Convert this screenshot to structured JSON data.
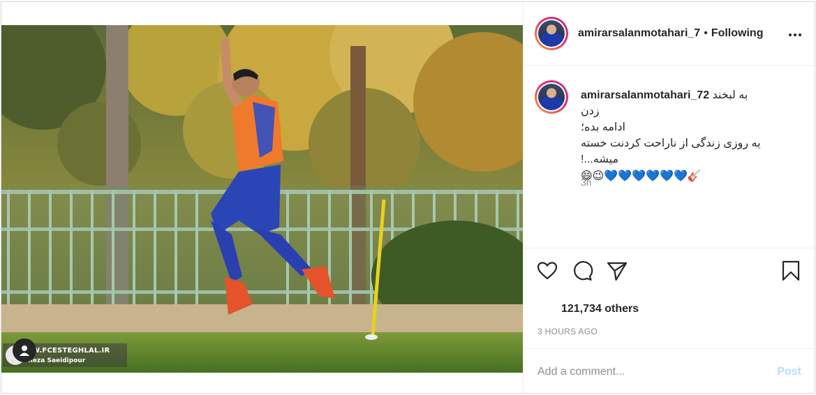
{
  "post": {
    "image": {
      "watermark_site": "W.FCESTEGHLAL.IR",
      "watermark_credit": "Reza Saeidipour",
      "tag_icon": "user-tag-icon"
    },
    "header": {
      "username": "amirarsalanmotahari_7",
      "separator": "•",
      "follow_label": "Following",
      "more_label": "•••"
    },
    "caption": {
      "username": "amirarsalanmotahari_72",
      "line1": "به لبخند زدن",
      "line2": "ادامه بده؛",
      "line3": "یه روزی زندگی از ناراحت کردنت خسته",
      "line4": "میشه...!",
      "emojis": "😄😉💙💙💙💙💙💙🎸",
      "time": "3h"
    },
    "actions": {
      "like_icon": "heart-icon",
      "comment_icon": "comment-icon",
      "share_icon": "paper-plane-icon",
      "save_icon": "bookmark-icon"
    },
    "likes_text": "121,734 others",
    "timestamp": "3 HOURS AGO",
    "comment": {
      "placeholder": "Add a comment...",
      "post_label": "Post"
    }
  }
}
